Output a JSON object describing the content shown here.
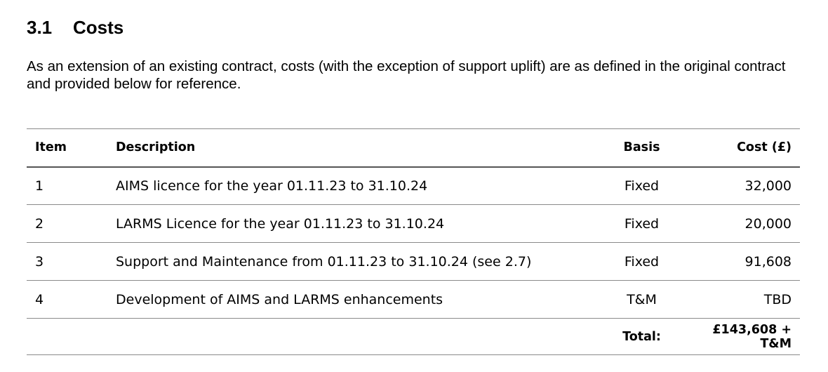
{
  "section": {
    "number": "3.1",
    "title": "Costs"
  },
  "intro": "As an extension of an existing contract, costs (with the exception of support uplift) are as defined in the original contract and provided below for reference.",
  "table": {
    "headers": {
      "item": "Item",
      "description": "Description",
      "basis": "Basis",
      "cost": "Cost (£)"
    },
    "rows": [
      {
        "item": "1",
        "description": "AIMS licence for the year 01.11.23 to 31.10.24",
        "basis": "Fixed",
        "cost": "32,000"
      },
      {
        "item": "2",
        "description": "LARMS Licence for the year 01.11.23 to 31.10.24",
        "basis": "Fixed",
        "cost": "20,000"
      },
      {
        "item": "3",
        "description": "Support and Maintenance from 01.11.23 to 31.10.24 (see 2.7)",
        "basis": "Fixed",
        "cost": "91,608"
      },
      {
        "item": "4",
        "description": "Development of AIMS and LARMS enhancements",
        "basis": "T&M",
        "cost": "TBD"
      }
    ],
    "total": {
      "label": "Total:",
      "value": "£143,608 + T&M"
    }
  }
}
